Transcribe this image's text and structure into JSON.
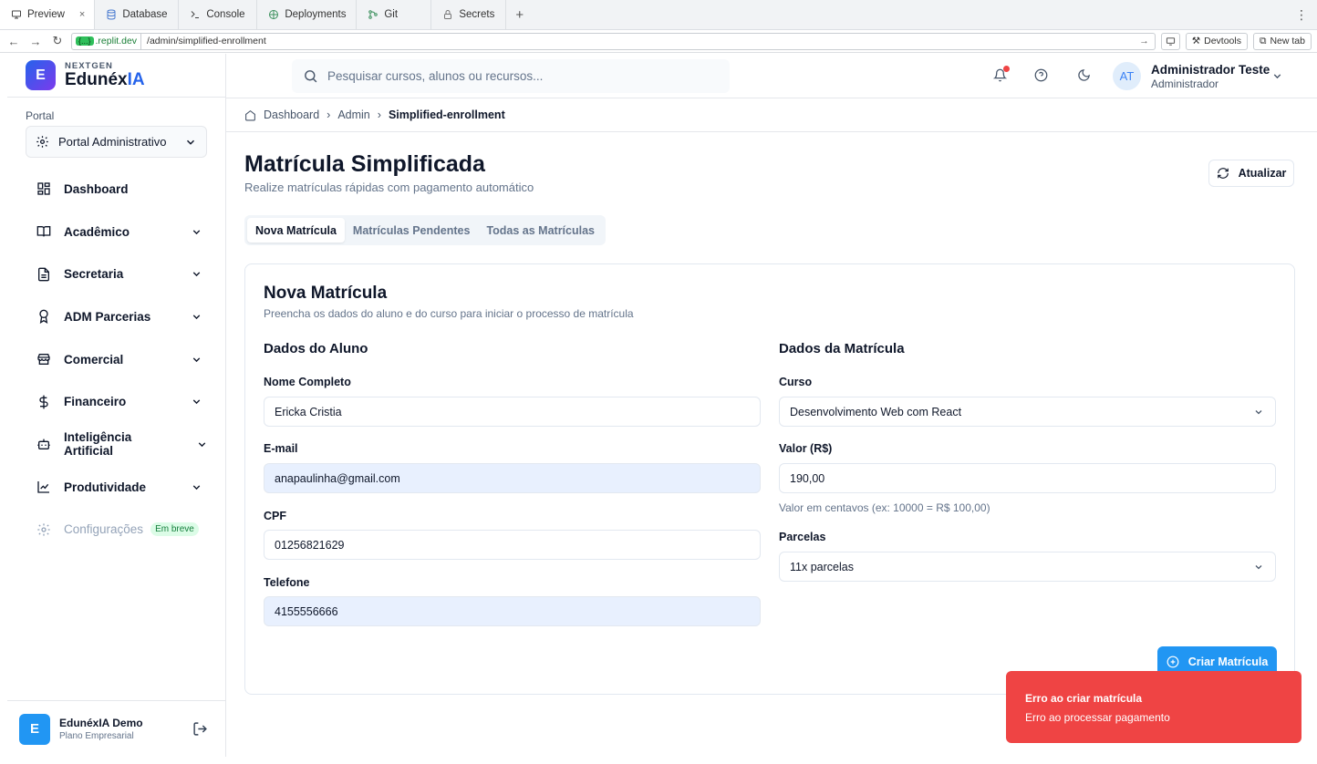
{
  "browser": {
    "tabs": [
      {
        "label": "Preview",
        "icon": "monitor-icon",
        "close": "×"
      },
      {
        "label": "Database",
        "icon": "database-icon"
      },
      {
        "label": "Console",
        "icon": "terminal-icon"
      },
      {
        "label": "Deployments",
        "icon": "deploy-icon"
      },
      {
        "label": "Git",
        "icon": "git-icon"
      },
      {
        "label": "Secrets",
        "icon": "lock-icon"
      }
    ],
    "new_tab": "+",
    "domain_tag": "{...}",
    "domain": ".replit.dev",
    "path": "/admin/simplified-enrollment",
    "devtools_label": "Devtools",
    "newtab_label": "New tab"
  },
  "brand": {
    "small": "NEXTGEN",
    "name_main": "Edunéx",
    "name_accent": "IA",
    "logo_letter": "E"
  },
  "sidebar": {
    "portal_label": "Portal",
    "portal_value": "Portal Administrativo",
    "items": [
      {
        "label": "Dashboard",
        "icon": "dashboard-icon"
      },
      {
        "label": "Acadêmico",
        "icon": "book-icon"
      },
      {
        "label": "Secretaria",
        "icon": "document-icon"
      },
      {
        "label": "ADM Parcerias",
        "icon": "award-icon"
      },
      {
        "label": "Comercial",
        "icon": "store-icon"
      },
      {
        "label": "Financeiro",
        "icon": "dollar-icon"
      },
      {
        "label": "Inteligência Artificial",
        "icon": "bot-icon"
      },
      {
        "label": "Produtividade",
        "icon": "chart-line-icon"
      },
      {
        "label": "Configurações",
        "icon": "gear-icon",
        "badge": "Em breve"
      }
    ],
    "footer": {
      "avatar": "E",
      "name": "EdunéxIA Demo",
      "plan": "Plano Empresarial"
    }
  },
  "header": {
    "search_placeholder": "Pesquisar cursos, alunos ou recursos...",
    "user_initials": "AT",
    "user_name": "Administrador Teste",
    "user_role": "Administrador"
  },
  "breadcrumb": [
    "Dashboard",
    "Admin",
    "Simplified-enrollment"
  ],
  "page": {
    "title": "Matrícula Simplificada",
    "subtitle": "Realize matrículas rápidas com pagamento automático",
    "refresh_label": "Atualizar",
    "tabs": [
      "Nova Matrícula",
      "Matrículas Pendentes",
      "Todas as Matrículas"
    ]
  },
  "form": {
    "title": "Nova Matrícula",
    "subtitle": "Preencha os dados do aluno e do curso para iniciar o processo de matrícula",
    "student_section": "Dados do Aluno",
    "enrollment_section": "Dados da Matrícula",
    "name_label": "Nome Completo",
    "name_value": "Ericka Cristia",
    "email_label": "E-mail",
    "email_value": "anapaulinha@gmail.com",
    "cpf_label": "CPF",
    "cpf_value": "01256821629",
    "phone_label": "Telefone",
    "phone_value": "4155556666",
    "course_label": "Curso",
    "course_value": "Desenvolvimento Web com React",
    "amount_label": "Valor (R$)",
    "amount_value": "190,00",
    "amount_hint": "Valor em centavos (ex: 10000 = R$ 100,00)",
    "installments_label": "Parcelas",
    "installments_value": "11x parcelas",
    "submit_label": "Criar Matrícula"
  },
  "toast": {
    "title": "Erro ao criar matrícula",
    "message": "Erro ao processar pagamento",
    "color": "#ef4444"
  }
}
